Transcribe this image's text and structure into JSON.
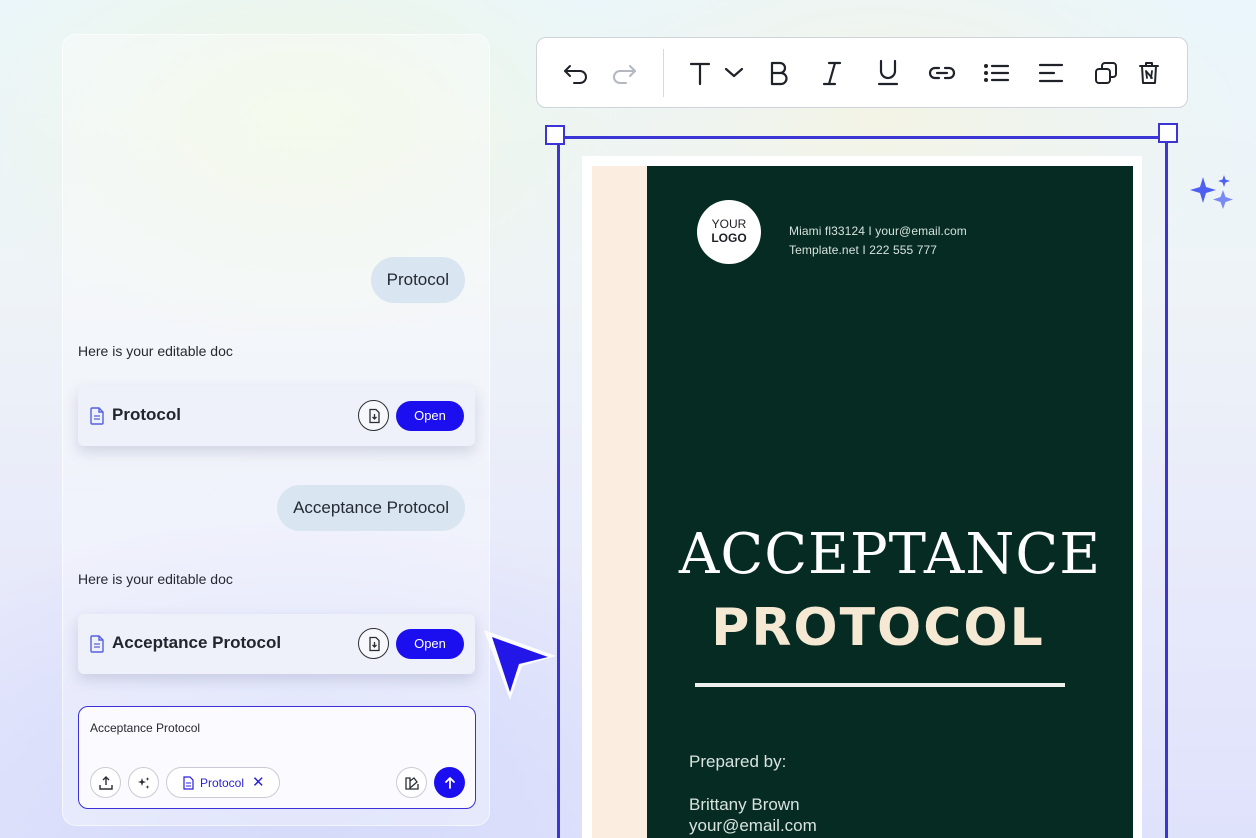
{
  "chat": {
    "messages": [
      {
        "role": "user",
        "text": "Protocol"
      },
      {
        "role": "assistant",
        "text": "Here is your editable doc"
      },
      {
        "role": "user",
        "text": "Acceptance Protocol"
      },
      {
        "role": "assistant",
        "text": "Here is your editable doc"
      }
    ],
    "cards": [
      {
        "title": "Protocol",
        "open_label": "Open"
      },
      {
        "title": "Acceptance Protocol",
        "open_label": "Open"
      }
    ],
    "composer": {
      "value": "Acceptance Protocol",
      "chip_label": "Protocol",
      "chip_close": "✕"
    }
  },
  "toolbar": {
    "tools": [
      "undo-icon",
      "redo-icon",
      "text-style-icon",
      "chevron-down-icon",
      "bold-icon",
      "italic-icon",
      "underline-icon",
      "link-icon",
      "bullet-list-icon",
      "align-left-icon",
      "duplicate-icon",
      "trash-icon"
    ]
  },
  "document": {
    "logo_line1": "YOUR",
    "logo_line2": "LOGO",
    "contact_line1": "Miami fl33124  I  your@email.com",
    "contact_line2": "Template.net  I  222 555 777",
    "title_line1": "ACCEPTANCE",
    "title_line2": "PROTOCOL",
    "prepared_label": "Prepared by:",
    "author_name": "Brittany Brown",
    "author_email": "your@email.com"
  },
  "colors": {
    "accent": "#1c0fef",
    "selection": "#3a35d4",
    "doc_dark": "#062b22",
    "doc_strip": "#fbeee0",
    "doc_title_2": "#f5e9d4"
  }
}
